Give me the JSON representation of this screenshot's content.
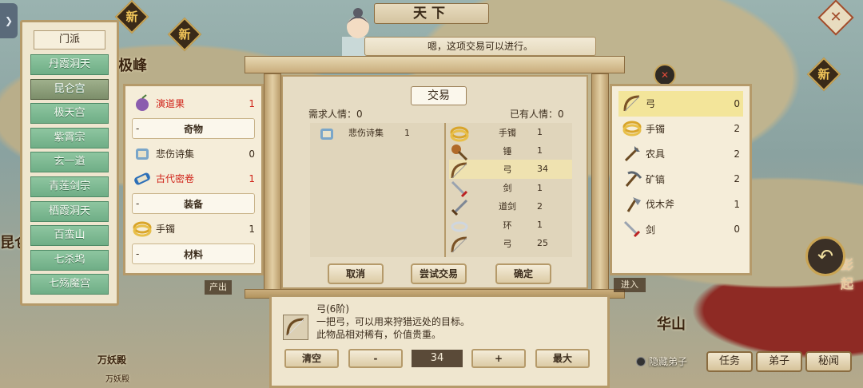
{
  "window": {
    "title": "天下"
  },
  "dialogue": {
    "text": "嗯，这项交易可以进行。"
  },
  "map": {
    "new_badge": "新",
    "labels": {
      "peak": "极峰",
      "kunlun": "昆仑",
      "huashan": "华山",
      "wanyao": "万妖殿",
      "wanyao_sub": "万妖殿",
      "output": "产出",
      "enter": "进入",
      "side_right": "彭起"
    }
  },
  "sect_list": {
    "header": "门派",
    "items": [
      "丹霞洞天",
      "昆仑宫",
      "极天宫",
      "紫霄宗",
      "玄一道",
      "青莲剑宗",
      "栖霞洞天",
      "百蛮山",
      "七杀坞",
      "七殇魔宫"
    ],
    "active_index": 1
  },
  "left_inventory": {
    "rows": [
      {
        "type": "item",
        "name": "演道果",
        "count": "1",
        "icon": "fruit-icon",
        "red": true
      },
      {
        "type": "section",
        "label": "奇物"
      },
      {
        "type": "item",
        "name": "悲伤诗集",
        "count": "0",
        "icon": "scroll-icon",
        "red": false
      },
      {
        "type": "item",
        "name": "古代密卷",
        "count": "1",
        "icon": "ancient-scroll-icon",
        "red": true
      },
      {
        "type": "section",
        "label": "装备"
      },
      {
        "type": "item",
        "name": "手镯",
        "count": "1",
        "icon": "bracelet-icon",
        "red": false
      },
      {
        "type": "section",
        "label": "材料"
      }
    ]
  },
  "trade": {
    "title": "交易",
    "need_label": "需求人情：0",
    "have_label": "已有人情：0",
    "offer": [
      {
        "name": "悲伤诗集",
        "count": "1",
        "icon": "scroll-icon"
      }
    ],
    "want": [
      {
        "name": "手镯",
        "count": "1",
        "icon": "bracelet-icon"
      },
      {
        "name": "锤",
        "count": "1",
        "icon": "hammer-icon"
      },
      {
        "name": "弓",
        "count": "34",
        "icon": "bow-icon",
        "highlight": true
      },
      {
        "name": "剑",
        "count": "1",
        "icon": "sword-icon"
      },
      {
        "name": "道剑",
        "count": "2",
        "icon": "dao-sword-icon"
      },
      {
        "name": "环",
        "count": "1",
        "icon": "ring-icon"
      },
      {
        "name": "弓",
        "count": "25",
        "icon": "bow-icon"
      }
    ],
    "buttons": {
      "cancel": "取消",
      "try": "尝试交易",
      "confirm": "确定"
    }
  },
  "right_inventory": {
    "rows": [
      {
        "name": "弓",
        "count": "0",
        "icon": "bow-icon",
        "selected": true
      },
      {
        "name": "手镯",
        "count": "2",
        "icon": "bracelet-icon"
      },
      {
        "name": "农具",
        "count": "2",
        "icon": "farm-tool-icon"
      },
      {
        "name": "矿镐",
        "count": "2",
        "icon": "pickaxe-icon"
      },
      {
        "name": "伐木斧",
        "count": "1",
        "icon": "axe-icon"
      },
      {
        "name": "剑",
        "count": "0",
        "icon": "sword-icon"
      }
    ]
  },
  "detail": {
    "name": "弓(6阶)",
    "desc1": "一把弓，可以用来狩猎远处的目标。",
    "desc2": "此物品相对稀有，价值贵重。",
    "clear": "清空",
    "minus": "-",
    "quantity": "34",
    "plus": "+",
    "max": "最大"
  },
  "bottom": {
    "hide_disciple": "隐藏弟子",
    "task": "任务",
    "disciple": "弟子",
    "secret": "秘闻"
  },
  "colors": {
    "red_item": "#d0241a",
    "sect_green": "#6fae86",
    "frame": "#b59a6a"
  }
}
